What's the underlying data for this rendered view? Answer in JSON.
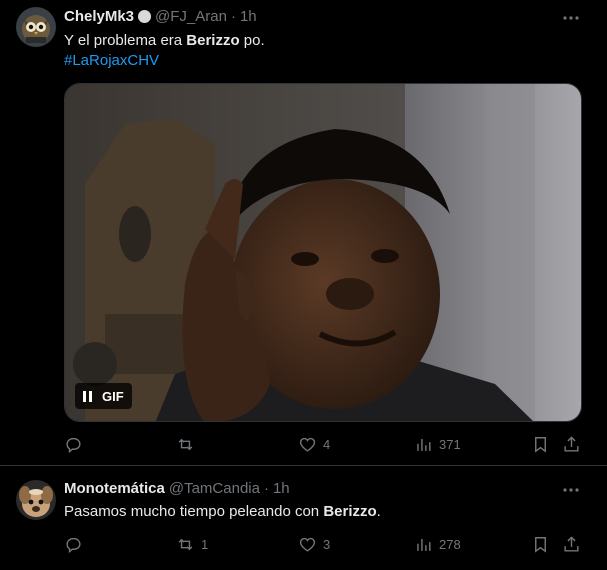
{
  "tweets": [
    {
      "author": "ChelyMk3",
      "handle": "@FJ_Aran",
      "separator": "·",
      "time": "1h",
      "text_before": "Y el problema era ",
      "text_bold": "Berizzo",
      "text_after": " po.",
      "hashtag": "#LaRojaxCHV",
      "media_badge": "GIF",
      "actions": {
        "reply_count": "",
        "retweet_count": "",
        "like_count": "4",
        "view_count": "371"
      }
    },
    {
      "author": "Monotemática",
      "handle": "@TamCandia",
      "separator": "·",
      "time": "1h",
      "text_before": "Pasamos mucho tiempo peleando con ",
      "text_bold": "Berizzo",
      "text_after": ".",
      "actions": {
        "reply_count": "",
        "retweet_count": "1",
        "like_count": "3",
        "view_count": "278"
      }
    }
  ],
  "colors": {
    "background": "#000000",
    "text": "#e7e9ea",
    "muted": "#71767b",
    "link": "#1d9bf0",
    "divider": "#2f3336"
  }
}
